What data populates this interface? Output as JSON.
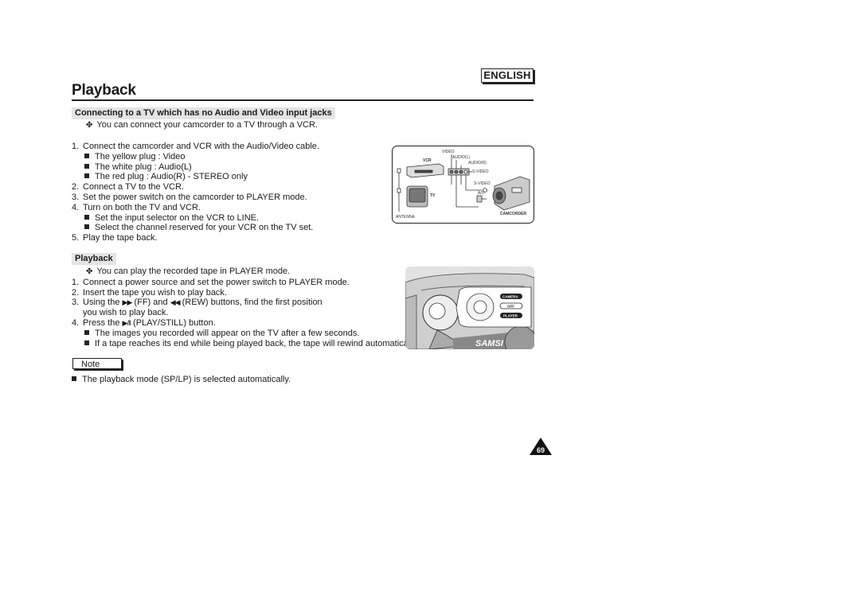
{
  "header": {
    "language_badge": "ENGLISH",
    "page_title": "Playback"
  },
  "section_connect": {
    "heading": "Connecting to a TV which has no Audio and Video input jacks",
    "intro": "You can connect your camcorder to a TV through a VCR.",
    "steps": [
      {
        "num": "1.",
        "text": "Connect the camcorder and VCR with the Audio/Video cable.",
        "bullets": [
          "The yellow plug :  Video",
          "The white plug :  Audio(L)",
          "The red plug :  Audio(R) - STEREO only"
        ]
      },
      {
        "num": "2.",
        "text": "Connect a TV to the VCR.",
        "bullets": []
      },
      {
        "num": "3.",
        "text": "Set the power switch on the camcorder to PLAYER mode.",
        "bullets": []
      },
      {
        "num": "4.",
        "text": "Turn on both the TV and VCR.",
        "bullets": [
          "Set the input selector on the VCR to LINE.",
          "Select the channel reserved for your VCR on the TV set."
        ]
      },
      {
        "num": "5.",
        "text": "Play the tape back.",
        "bullets": []
      }
    ],
    "diagram_labels": {
      "video": "VIDEO",
      "audio_l": "AUDIO(L)",
      "audio_r": "AUDIO(R)",
      "s_video": "S-VIDEO",
      "s_video_2": "S-VIDEO",
      "av": "A/V",
      "vcr": "VCR",
      "tv": "TV",
      "antenna": "ANTENNA",
      "camcorder": "CAMCORDER"
    }
  },
  "section_playback": {
    "heading": "Playback",
    "intro": "You can play the recorded tape in PLAYER mode.",
    "steps": [
      {
        "num": "1.",
        "text": "Connect a power source and set the power switch to PLAYER mode."
      },
      {
        "num": "2.",
        "text": "Insert the tape you wish to play back."
      },
      {
        "num": "3.",
        "pre": "Using the",
        "ff_symbol": "▶▶",
        "mid": "(FF) and",
        "rew_symbol": "◀◀",
        "post": "(REW) buttons, find the first position",
        "cont": "you wish to play back."
      },
      {
        "num": "4.",
        "pre": "Press the",
        "play_symbol": "▶/II",
        "post": "(PLAY/STILL) button.",
        "bullets": [
          "The images you recorded will appear on the TV after a few seconds.",
          "If a tape reaches its end while being played back, the tape will rewind automatically."
        ]
      }
    ],
    "dial_labels": {
      "camera": "CAMERA",
      "off": "OFF",
      "player": "PLAYER",
      "brand_partial": "SAMSI"
    }
  },
  "note": {
    "label": "Note",
    "items": [
      "The playback mode (SP/LP) is selected automatically."
    ]
  },
  "footer": {
    "page_number": "69"
  }
}
